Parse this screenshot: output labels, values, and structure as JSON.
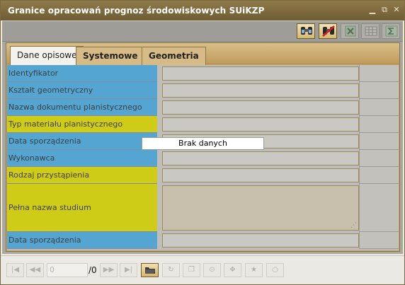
{
  "window": {
    "title": "Granice opracowań prognoz środowiskowych SUiKZP",
    "controls": [
      {
        "name": "minimize-button",
        "icon": "minimize-icon",
        "glyph": "▁"
      },
      {
        "name": "popout-button",
        "icon": "popout-icon",
        "glyph": "⧉"
      },
      {
        "name": "close-button",
        "icon": "close-icon",
        "glyph": "✕"
      }
    ]
  },
  "toolbar": {
    "buttons": [
      {
        "name": "edit-record-button",
        "icon": "binoculars-edit-icon",
        "enabled": true
      },
      {
        "name": "delete-record-button",
        "icon": "binoculars-delete-icon",
        "enabled": true
      },
      {
        "name": "export-excel-button",
        "icon": "excel-icon",
        "enabled": false
      },
      {
        "name": "table-view-button",
        "icon": "table-icon",
        "enabled": false
      },
      {
        "name": "sum-button",
        "icon": "sigma-icon",
        "enabled": false
      }
    ]
  },
  "tabs": [
    {
      "label": "Dane opisowe",
      "active": true
    },
    {
      "label": "Systemowe",
      "active": false
    },
    {
      "label": "Geometria",
      "active": false
    }
  ],
  "fields": [
    {
      "label": "Identyfikator",
      "value": "",
      "color": "blue",
      "multiline": false
    },
    {
      "label": "Kształt geometryczny",
      "value": "",
      "color": "blue",
      "multiline": false
    },
    {
      "label": "Nazwa dokumentu planistycznego",
      "value": "",
      "color": "blue",
      "multiline": false
    },
    {
      "label": "Typ materiału planistycznego",
      "value": "",
      "color": "yellow",
      "multiline": false
    },
    {
      "label": "Data sporządzenia",
      "value": "",
      "color": "blue",
      "multiline": false
    },
    {
      "label": "Wykonawca",
      "value": "",
      "color": "blue",
      "multiline": false
    },
    {
      "label": "Rodzaj przystąpienia",
      "value": "",
      "color": "yellow",
      "multiline": false
    },
    {
      "label": "Pełna nazwa studium",
      "value": "",
      "color": "yellow",
      "multiline": true
    },
    {
      "label": "Data sporządzenia",
      "value": "",
      "color": "blue",
      "multiline": false
    }
  ],
  "colors": {
    "blue": "#55a5d2",
    "yellow": "#cfcc18"
  },
  "overlay": {
    "text": "Brak danych"
  },
  "navigation": {
    "page_value": "0",
    "page_total": "/0",
    "buttons": [
      {
        "name": "first-page-button",
        "icon": "first-icon",
        "glyph": "|◀"
      },
      {
        "name": "prev-page-button",
        "icon": "prev-icon",
        "glyph": "◀◀"
      },
      {
        "name": "next-page-button",
        "icon": "next-icon",
        "glyph": "▶▶"
      },
      {
        "name": "last-page-button",
        "icon": "last-icon",
        "glyph": "▶|"
      },
      {
        "name": "open-folder-button",
        "icon": "folder-icon",
        "glyph": "▰",
        "active": true
      },
      {
        "name": "refresh-button",
        "icon": "refresh-icon",
        "glyph": "↻"
      },
      {
        "name": "copy-button",
        "icon": "copy-icon",
        "glyph": "❐"
      },
      {
        "name": "search-button",
        "icon": "search-icon",
        "glyph": "⊙"
      },
      {
        "name": "move-button",
        "icon": "move-icon",
        "glyph": "✥"
      },
      {
        "name": "favorite-button",
        "icon": "star-icon",
        "glyph": "★"
      },
      {
        "name": "point-button",
        "icon": "circle-icon",
        "glyph": "○"
      }
    ]
  }
}
